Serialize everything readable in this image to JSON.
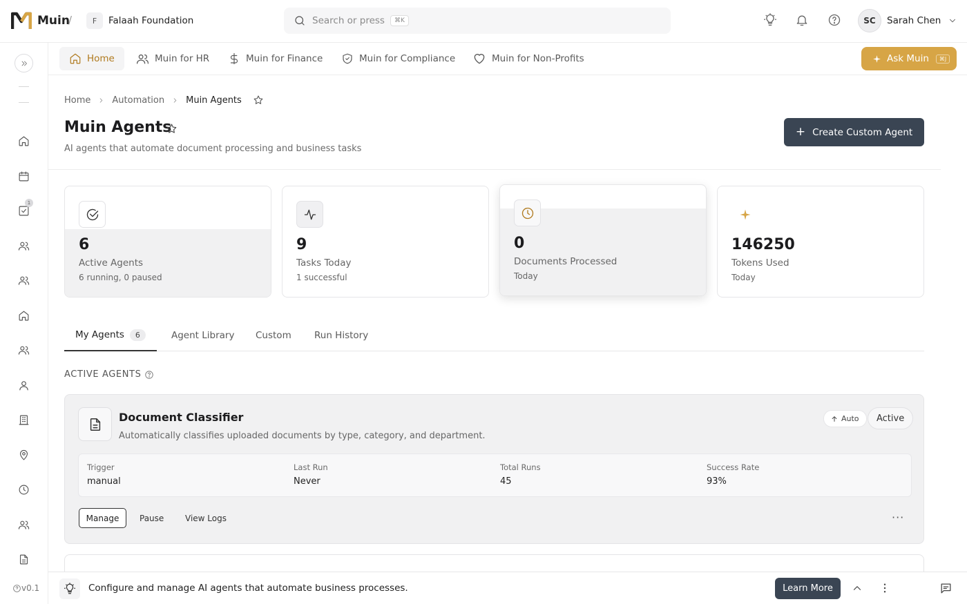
{
  "app": {
    "name": "Muin",
    "org_initial": "F",
    "org_name": "Falaah Foundation"
  },
  "search": {
    "placeholder": "Search or press",
    "shortcut": "⌘K"
  },
  "user": {
    "initials": "SC",
    "name": "Sarah Chen"
  },
  "rail": {
    "toggle_icon": "chevrons-right-icon",
    "version": "v0.1",
    "tasks_badge": "1"
  },
  "nav": {
    "items": [
      {
        "label": "Home",
        "icon": "home-icon",
        "active": true
      },
      {
        "label": "Muin for HR",
        "icon": "users-icon"
      },
      {
        "label": "Muin for Finance",
        "icon": "dollar-icon"
      },
      {
        "label": "Muin for Compliance",
        "icon": "shield-icon"
      },
      {
        "label": "Muin for Non-Profits",
        "icon": "heart-icon"
      }
    ],
    "ask": {
      "label": "Ask Muin",
      "shortcut": "⌘J"
    }
  },
  "breadcrumb": {
    "items": [
      "Home",
      "Automation",
      "Muin Agents"
    ]
  },
  "page": {
    "title": "Muin Agents",
    "subtitle": "AI agents that automate document processing and business tasks",
    "create_button": "Create Custom Agent"
  },
  "stats": [
    {
      "value": "6",
      "label": "Active Agents",
      "sub": "6 running, 0 paused",
      "icon": "check-circle-icon"
    },
    {
      "value": "9",
      "label": "Tasks Today",
      "sub": "1 successful",
      "icon": "activity-icon"
    },
    {
      "value": "0",
      "label": "Documents Processed",
      "sub": "Today",
      "icon": "clock-icon"
    },
    {
      "value": "146250",
      "label": "Tokens Used",
      "sub": "Today",
      "icon": "sparkle-icon"
    }
  ],
  "tabs": [
    {
      "label": "My Agents",
      "count": "6",
      "active": true
    },
    {
      "label": "Agent Library"
    },
    {
      "label": "Custom"
    },
    {
      "label": "Run History"
    }
  ],
  "section": {
    "label": "ACTIVE AGENTS"
  },
  "agent": {
    "title": "Document Classifier",
    "description": "Automatically classifies uploaded documents by type, category, and department.",
    "mode": "Auto",
    "status": "Active",
    "stats": [
      {
        "label": "Trigger",
        "value": "manual"
      },
      {
        "label": "Last Run",
        "value": "Never"
      },
      {
        "label": "Total Runs",
        "value": "45"
      },
      {
        "label": "Success Rate",
        "value": "93%"
      }
    ],
    "actions": {
      "manage": "Manage",
      "pause": "Pause",
      "logs": "View Logs",
      "more": "···"
    }
  },
  "bottom": {
    "message": "Configure and manage AI agents that automate business processes.",
    "learn_more": "Learn More"
  },
  "colors": {
    "accent": "#d7a546",
    "primary_button": "#3a4553",
    "active_nav": "#b07a1e"
  }
}
